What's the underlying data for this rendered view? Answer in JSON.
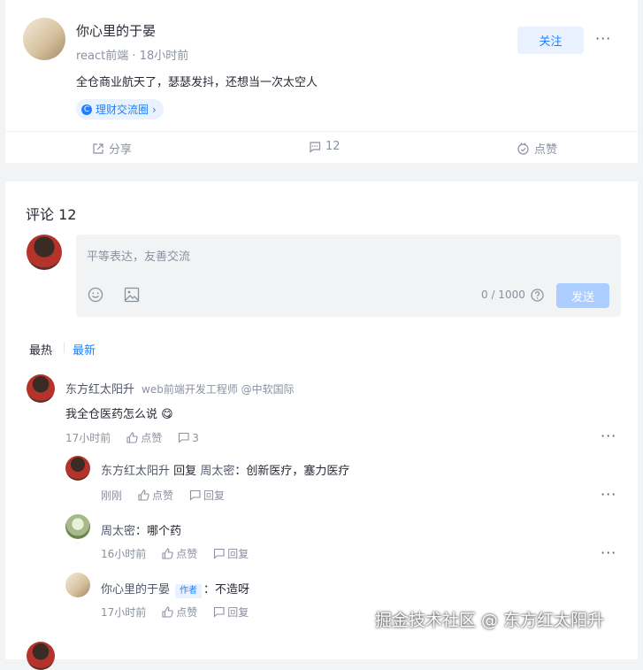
{
  "post": {
    "author_name": "你心里的于晏",
    "author_title": "react前端",
    "time": "18小时前",
    "follow_label": "关注",
    "more_label": "···",
    "content": "全仓商业航天了，瑟瑟发抖，还想当一次太空人",
    "tag_label": "理财交流圈",
    "actions": {
      "share": "分享",
      "comments": "12",
      "like": "点赞"
    }
  },
  "comments_section": {
    "title": "评论 12",
    "input_placeholder": "平等表达，友善交流",
    "char_count": "0 / 1000",
    "send_label": "发送",
    "sort": {
      "hot": "最热",
      "new": "最新"
    }
  },
  "comments": [
    {
      "name": "东方红太阳升",
      "title": "web前端开发工程师 @中软国际",
      "content": "我全仓医药怎么说 😋",
      "time": "17小时前",
      "like_label": "点赞",
      "reply_count": "3",
      "replies": [
        {
          "name": "东方红太阳升",
          "reply_word": "回复",
          "target": "周太密",
          "content": "：创新医疗，塞力医疗",
          "time": "刚刚",
          "like_label": "点赞",
          "reply_label": "回复"
        },
        {
          "name": "周太密",
          "content": "：哪个药",
          "time": "16小时前",
          "like_label": "点赞",
          "reply_label": "回复"
        },
        {
          "name": "你心里的于晏",
          "badge": "作者",
          "content": "：不造呀",
          "time": "17小时前",
          "like_label": "点赞",
          "reply_label": "回复"
        }
      ]
    }
  ],
  "watermark": "掘金技术社区 @ 东方红太阳升",
  "colors": {
    "accent": "#1e80ff",
    "page_bg": "#f2f3f5",
    "muted": "#8a919f"
  }
}
